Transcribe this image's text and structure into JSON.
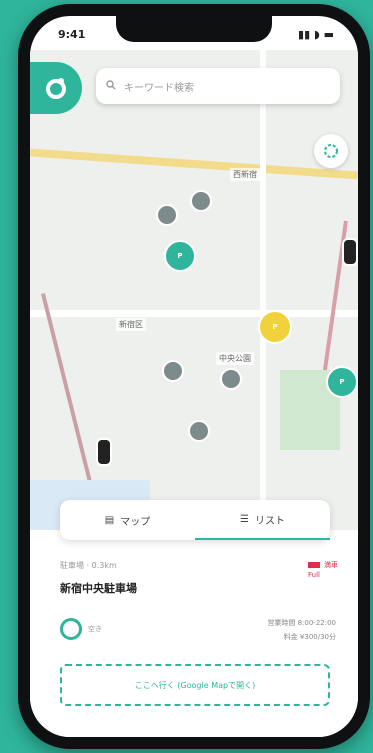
{
  "status": {
    "time": "9:41",
    "icons": "▮▮ ◗ ▬"
  },
  "search": {
    "placeholder": "キーワード検索"
  },
  "map": {
    "labels": [
      "西新宿",
      "新宿区",
      "中央公園"
    ],
    "pins_teal": [
      "P",
      "P"
    ],
    "pin_yellow": "P"
  },
  "tabs": {
    "left": "マップ",
    "right": "リスト"
  },
  "station": {
    "subtitle": "駐車場 · 0.3km",
    "name": "新宿中央駐車場"
  },
  "badge": {
    "line1": "満車",
    "line2": "Full"
  },
  "hours": {
    "line1": "営業時間 8:00-22:00",
    "line2": "料金 ¥300/30分"
  },
  "ring_label": "空き",
  "google_map_button": "ここへ行く (Google Mapで開く)",
  "colors": {
    "accent": "#2fb59c",
    "badge": "#d8314f",
    "yellow": "#f2d23c"
  }
}
